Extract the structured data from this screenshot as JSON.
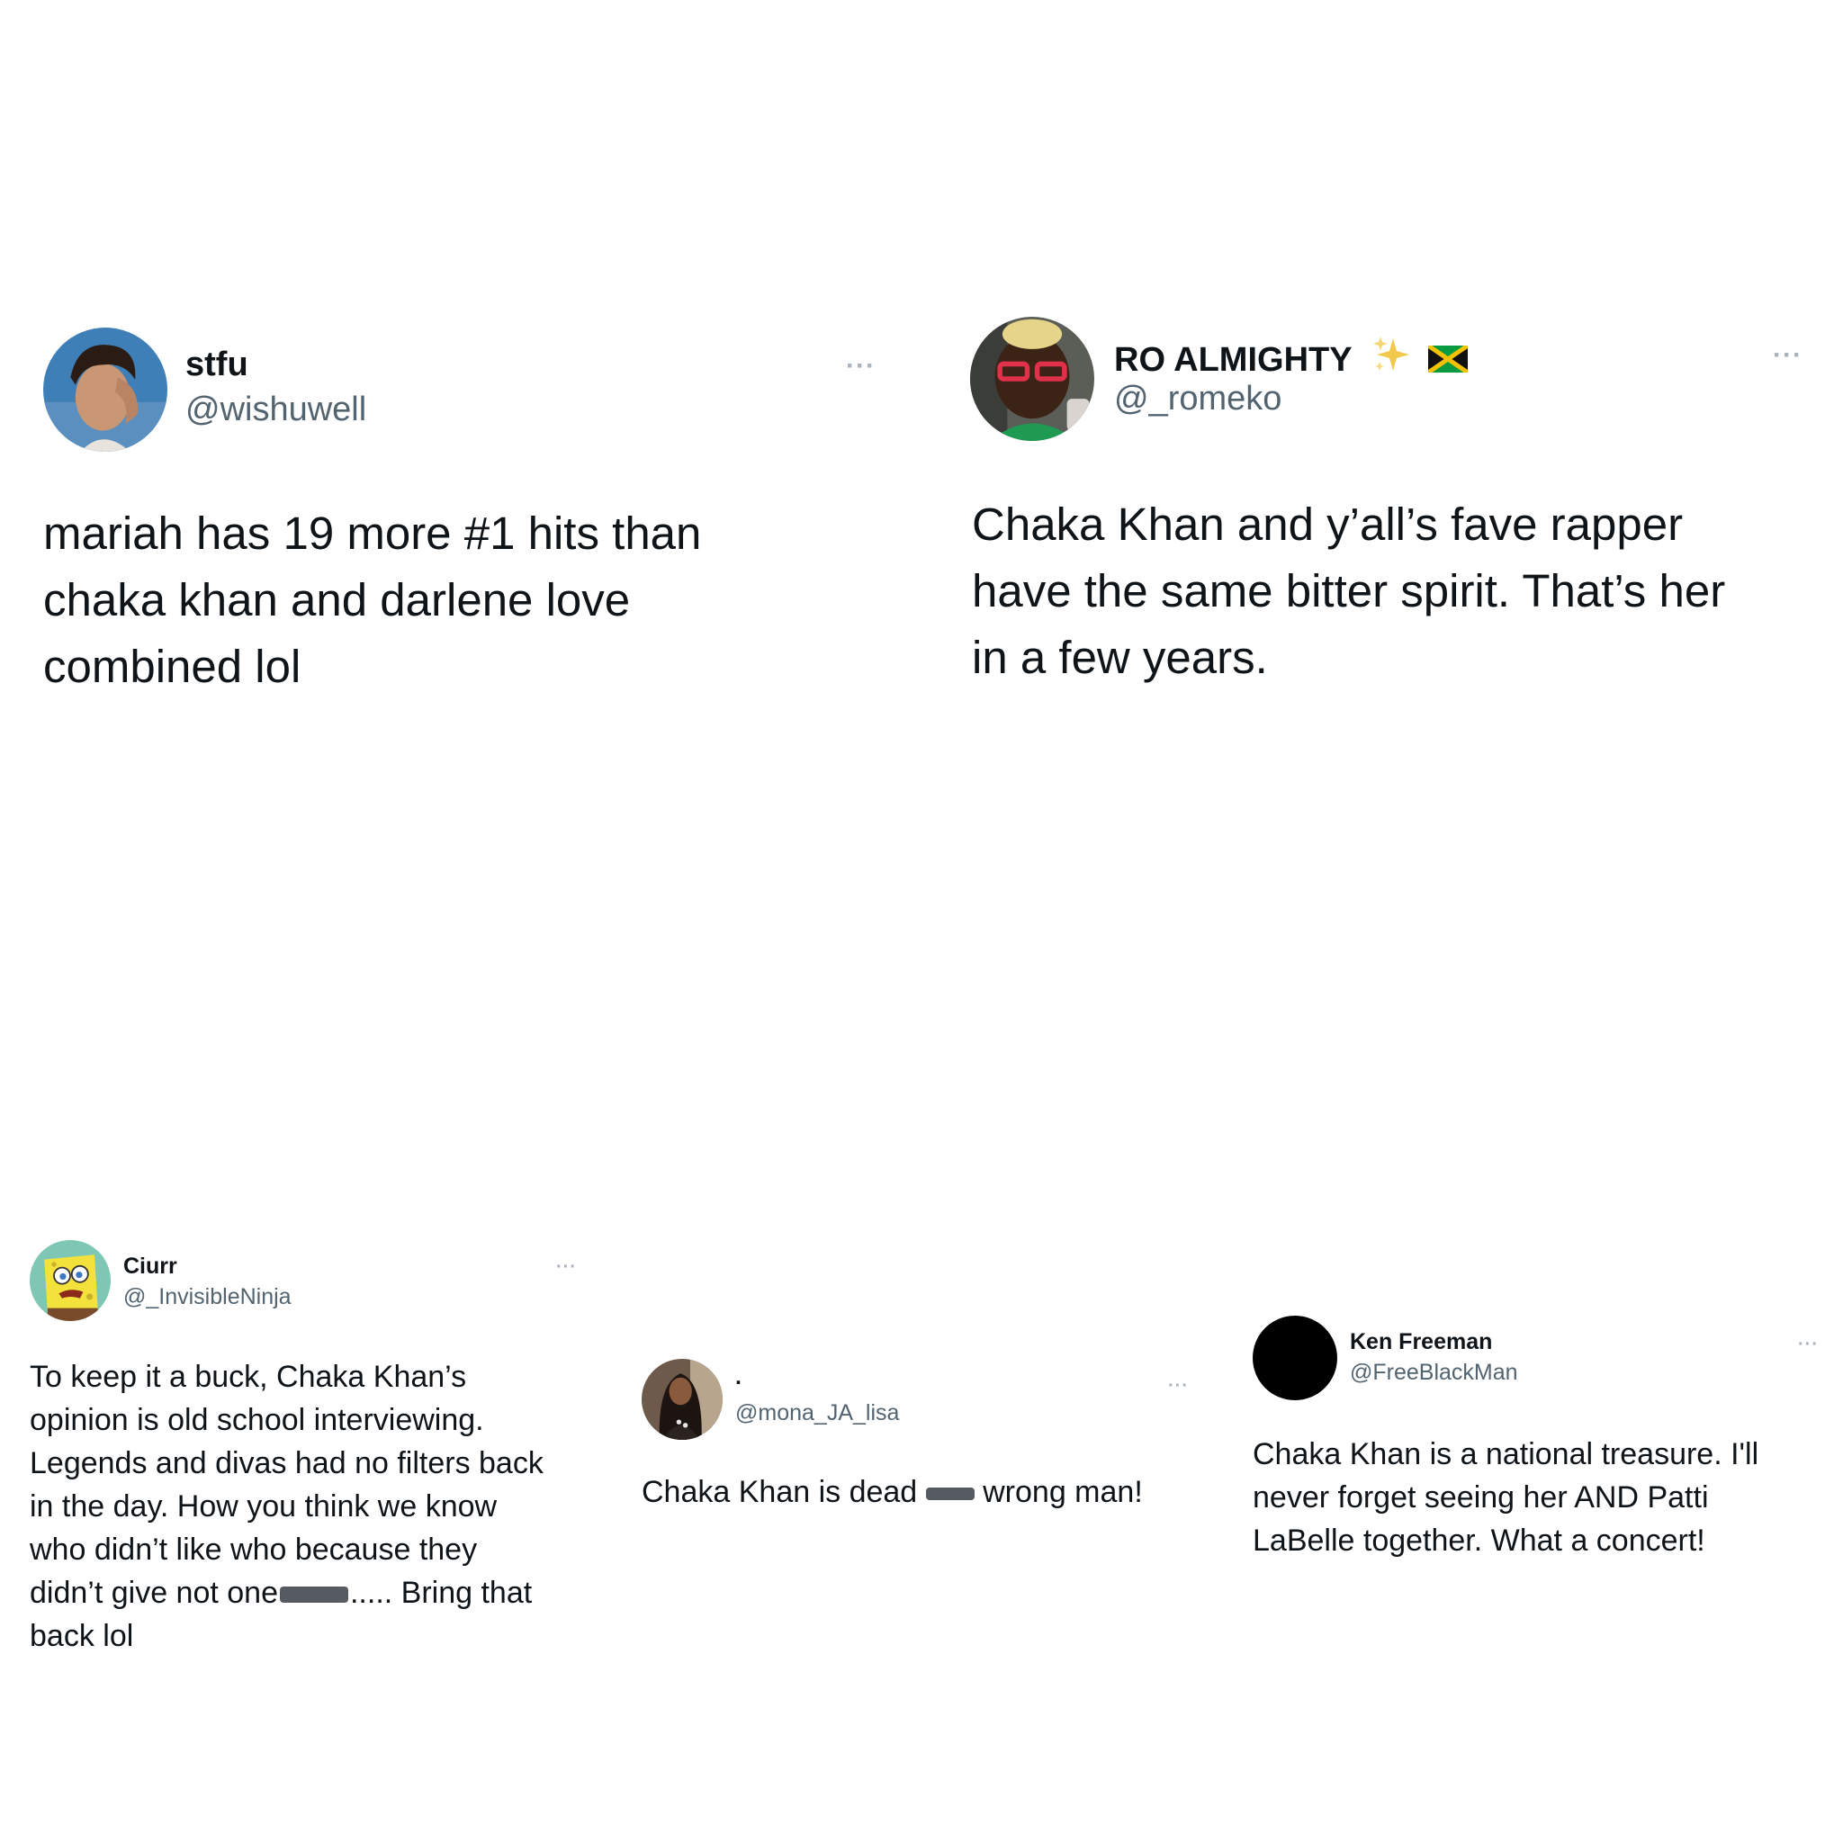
{
  "tweets": [
    {
      "name": "stfu",
      "handle": "@wishuwell",
      "more": "···",
      "avatar_icon": "person-photo-avatar",
      "lines": [
        "mariah has 19 more #1 hits than",
        "chaka khan and darlene love",
        "combined lol"
      ]
    },
    {
      "name": "RO ALMIGHTY",
      "handle": "@_romeko",
      "more": "···",
      "avatar_icon": "person-red-glasses-avatar",
      "name_emojis": [
        "sparkles-emoji",
        "jamaica-flag-emoji"
      ],
      "lines": [
        "Chaka Khan and y’all’s fave rapper",
        "have the same bitter spirit. That’s her",
        "in a few years."
      ]
    },
    {
      "name": "Ciurr",
      "handle": "@_InvisibleNinja",
      "more": "···",
      "avatar_icon": "cartoon-sponge-avatar",
      "lines": [
        "To keep it a buck, Chaka Khan’s",
        "opinion is old school interviewing.",
        "Legends and divas had no filters back",
        "in the day. How you think we know",
        "who didn’t like who because they"
      ],
      "line6_before": "didn’t give not one",
      "line6_after": "..... Bring that",
      "line7": "back lol"
    },
    {
      "name": ".",
      "handle": "@mona_JA_lisa",
      "more": "···",
      "avatar_icon": "woman-photo-avatar",
      "text_before": "Chaka Khan is dead",
      "text_after": "wrong man!"
    },
    {
      "name": "Ken Freeman",
      "handle": "@FreeBlackMan",
      "more": "···",
      "avatar_icon": "black-circle-avatar",
      "lines": [
        "Chaka Khan is a national treasure. I'll",
        "never forget seeing her AND Patti",
        "LaBelle together. What a concert!"
      ]
    }
  ],
  "colors": {
    "text": "#0f1419",
    "handle": "#536471",
    "more": "#a9b3bd",
    "censor": "#555b61"
  }
}
